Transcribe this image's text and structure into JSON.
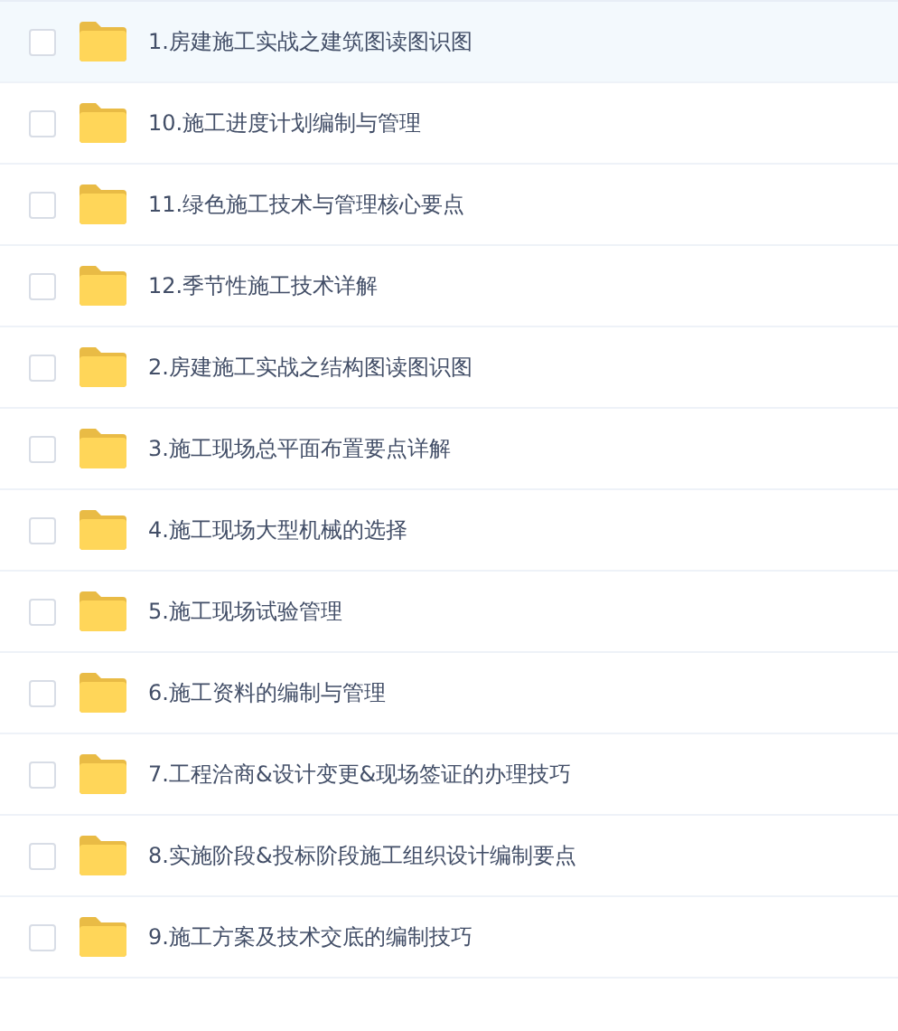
{
  "files": [
    {
      "name": "1.房建施工实战之建筑图读图识图",
      "selected": true,
      "checked": false
    },
    {
      "name": "10.施工进度计划编制与管理",
      "selected": false,
      "checked": false
    },
    {
      "name": "11.绿色施工技术与管理核心要点",
      "selected": false,
      "checked": false
    },
    {
      "name": "12.季节性施工技术详解",
      "selected": false,
      "checked": false
    },
    {
      "name": "2.房建施工实战之结构图读图识图",
      "selected": false,
      "checked": false
    },
    {
      "name": "3.施工现场总平面布置要点详解",
      "selected": false,
      "checked": false
    },
    {
      "name": "4.施工现场大型机械的选择",
      "selected": false,
      "checked": false
    },
    {
      "name": "5.施工现场试验管理",
      "selected": false,
      "checked": false
    },
    {
      "name": "6.施工资料的编制与管理",
      "selected": false,
      "checked": false
    },
    {
      "name": "7.工程洽商&设计变更&现场签证的办理技巧",
      "selected": false,
      "checked": false
    },
    {
      "name": "8.实施阶段&投标阶段施工组织设计编制要点",
      "selected": false,
      "checked": false
    },
    {
      "name": "9.施工方案及技术交底的编制技巧",
      "selected": false,
      "checked": false
    }
  ]
}
